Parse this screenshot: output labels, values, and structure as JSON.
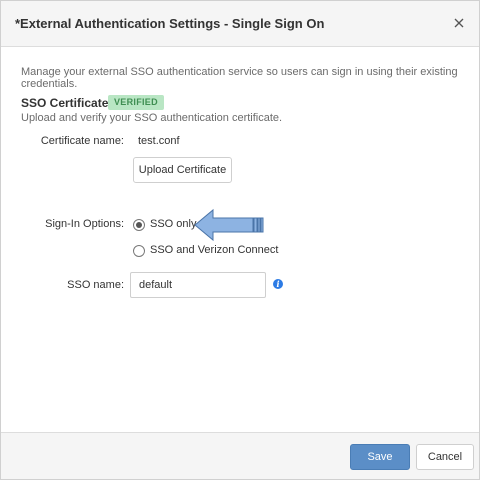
{
  "dialog": {
    "title": "*External Authentication Settings - Single Sign On",
    "close_icon": "close-icon"
  },
  "description": "Manage your external SSO authentication service so users can sign in using their existing credentials.",
  "certificate": {
    "section_title": "SSO Certificate",
    "badge": "VERIFIED",
    "badge_bg": "#b9e6c4",
    "badge_fg": "#3f8e52",
    "subtext": "Upload and verify your SSO authentication certificate.",
    "name_label": "Certificate name:",
    "name_value": "test.conf",
    "upload_label": "Upload Certificate"
  },
  "sign_in": {
    "label": "Sign-In Options:",
    "options": [
      {
        "label": "SSO only",
        "selected": true
      },
      {
        "label": "SSO and Verizon Connect",
        "selected": false
      }
    ],
    "arrow_icon": "left-arrow-icon"
  },
  "sso_name": {
    "label": "SSO name:",
    "value": "default",
    "info_icon": "info-icon"
  },
  "footer": {
    "save_label": "Save",
    "cancel_label": "Cancel",
    "accent": "#5b8ec7"
  }
}
